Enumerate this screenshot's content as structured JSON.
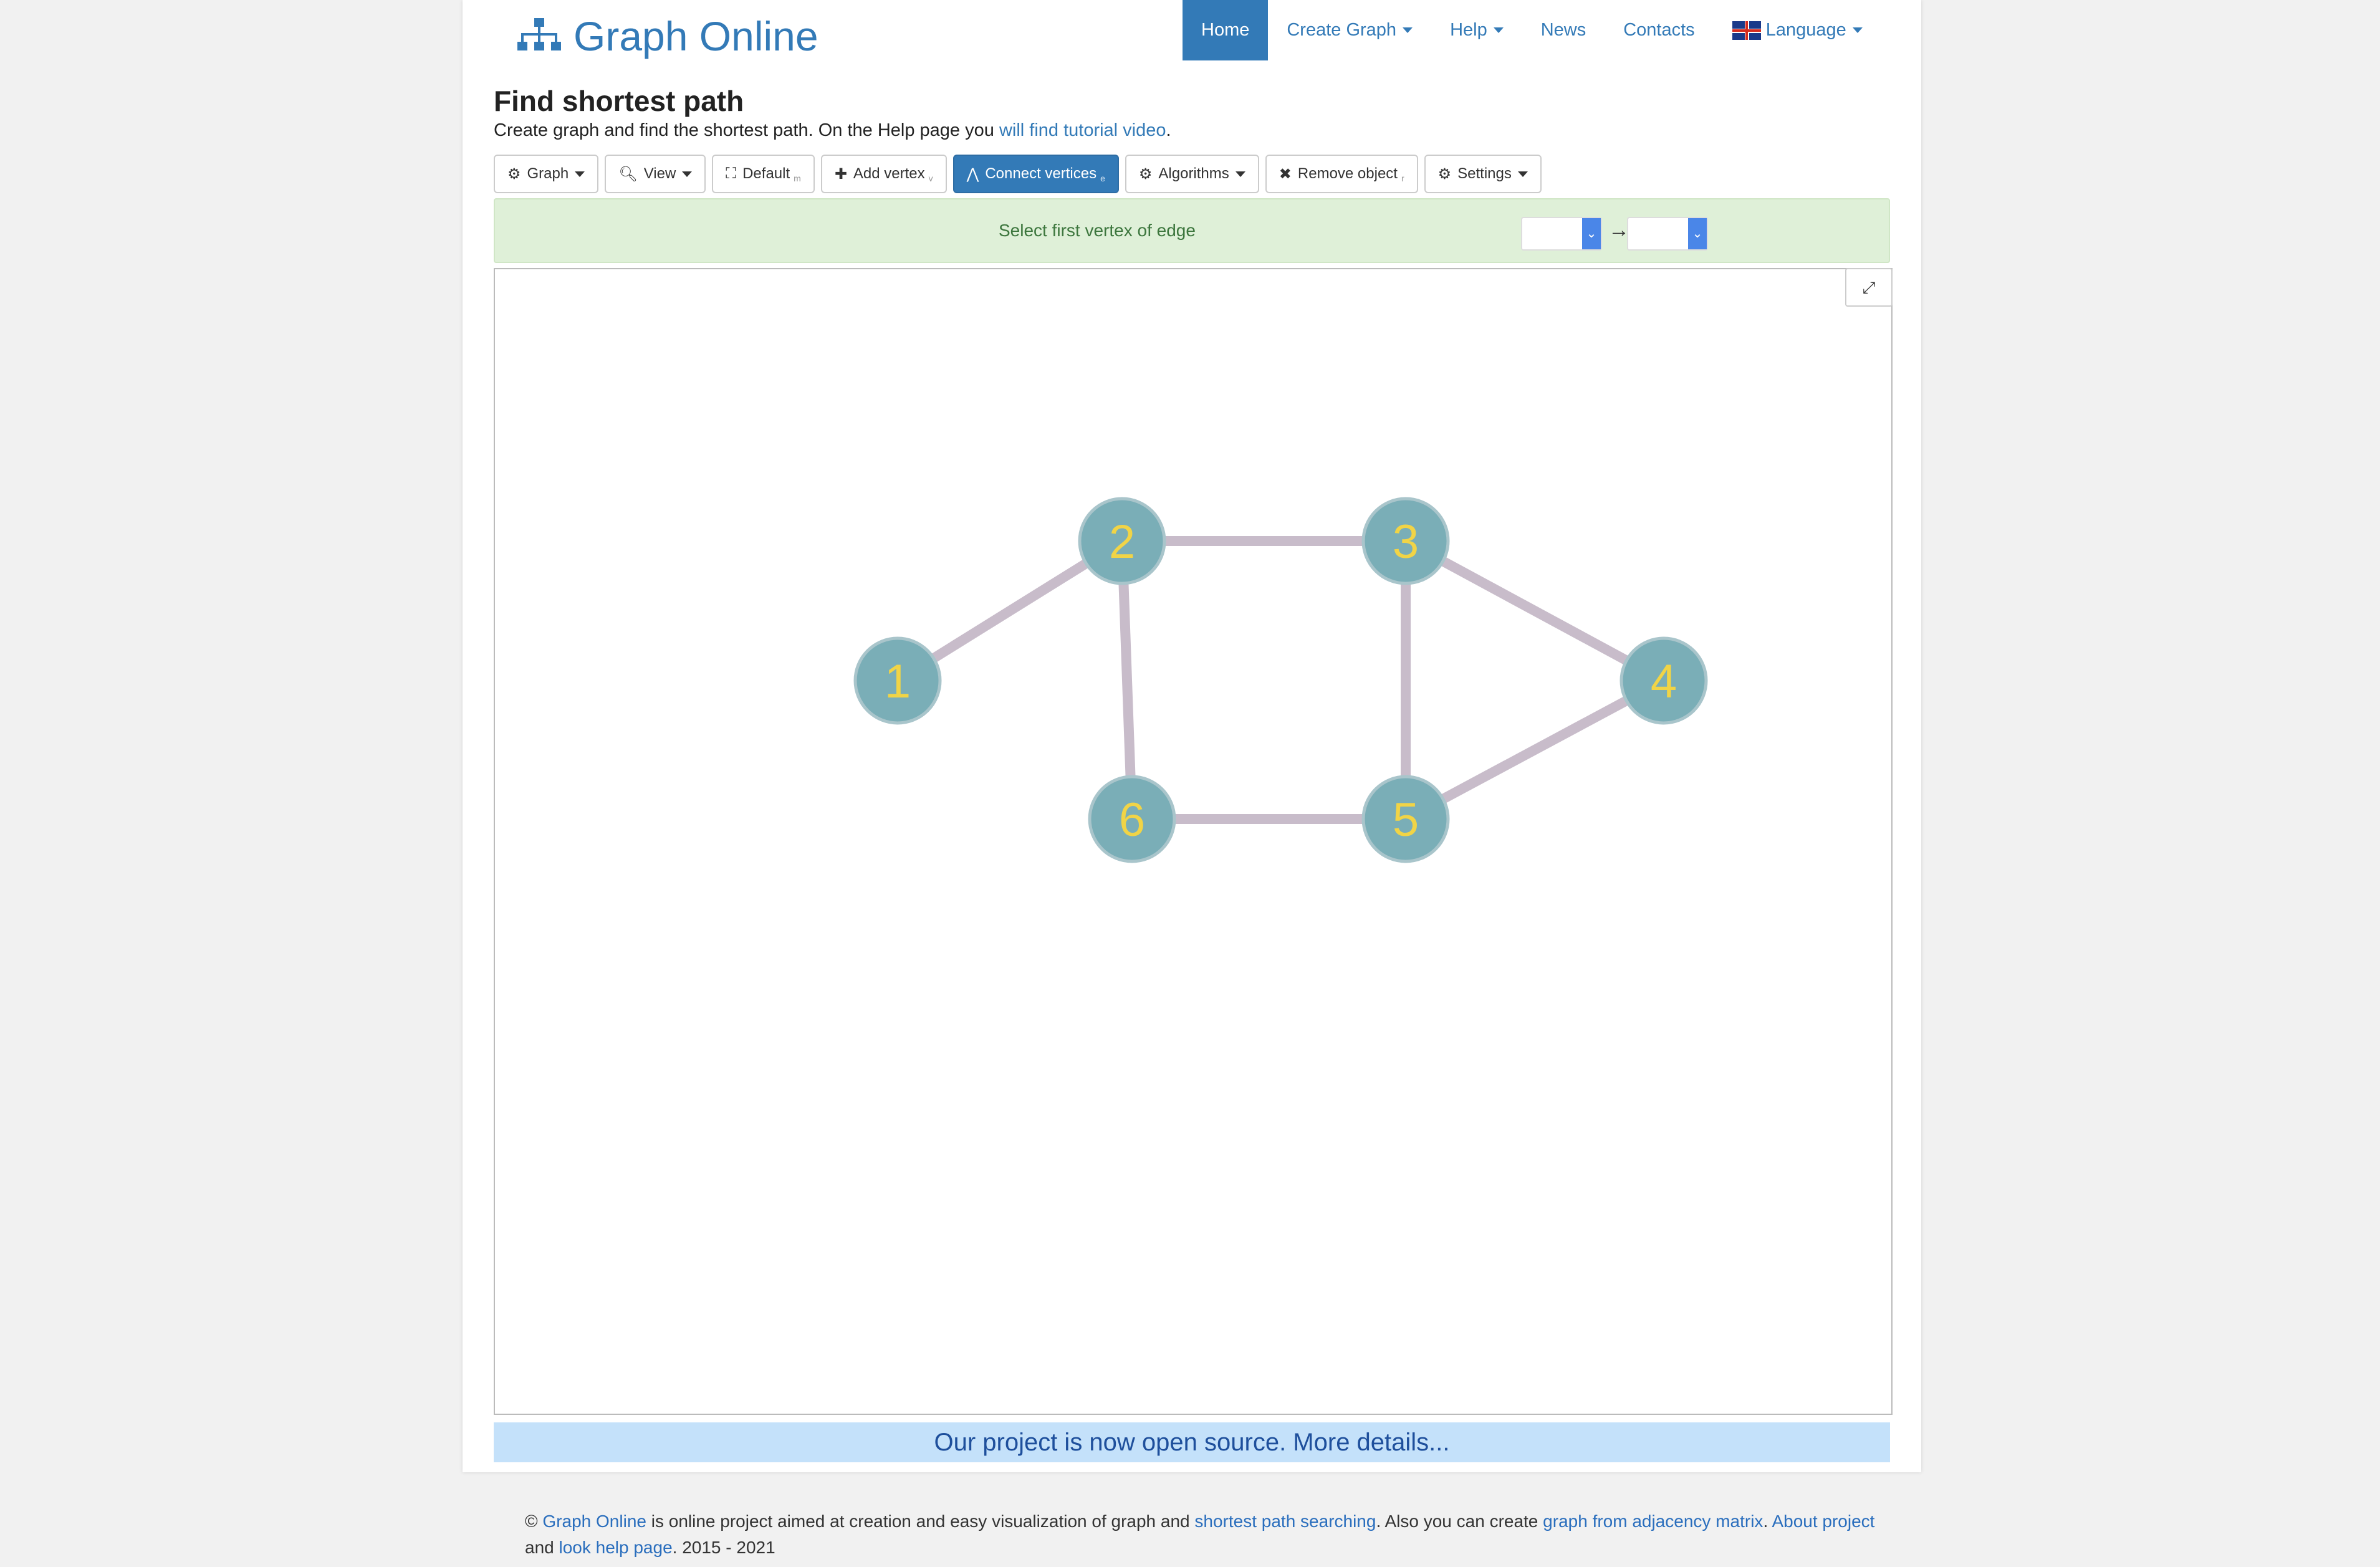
{
  "brand": {
    "name": "Graph Online",
    "icon": "sitemap-icon"
  },
  "nav": {
    "items": [
      {
        "label": "Home",
        "active": true
      },
      {
        "label": "Create Graph",
        "dropdown": true
      },
      {
        "label": "Help",
        "dropdown": true
      },
      {
        "label": "News"
      },
      {
        "label": "Contacts"
      }
    ],
    "language": {
      "label": "Language",
      "icon": "uk-flag-icon"
    }
  },
  "page": {
    "title": "Find shortest path",
    "subtitle_text": "Create graph and find the shortest path. On the Help page you ",
    "subtitle_link": "will find tutorial video",
    "subtitle_end": "."
  },
  "toolbar": {
    "graph": {
      "label": "Graph",
      "icon": "gear-icon"
    },
    "view": {
      "label": "View",
      "icon": "zoom-icon"
    },
    "default": {
      "label": "Default",
      "hotkey": "m",
      "icon": "fullscreen-icon"
    },
    "add_vertex": {
      "label": "Add vertex",
      "hotkey": "v",
      "icon": "plus-icon"
    },
    "connect": {
      "label": "Connect vertices",
      "hotkey": "e",
      "icon": "connect-icon"
    },
    "algorithms": {
      "label": "Algorithms",
      "icon": "gear-icon"
    },
    "remove": {
      "label": "Remove object",
      "hotkey": "r",
      "icon": "x-icon"
    },
    "settings": {
      "label": "Settings",
      "icon": "gear-icon"
    }
  },
  "alert": {
    "text": "Select first vertex of edge",
    "arrow": "→"
  },
  "graph": {
    "colors": {
      "vertex": "#7aaeb7",
      "vertex_label": "#f1d446",
      "edge": "#c8bcca",
      "vertex_border": "#a9c5cb"
    },
    "vertices": [
      {
        "id": "1",
        "label": "1"
      },
      {
        "id": "2",
        "label": "2"
      },
      {
        "id": "3",
        "label": "3"
      },
      {
        "id": "4",
        "label": "4"
      },
      {
        "id": "5",
        "label": "5"
      },
      {
        "id": "6",
        "label": "6"
      }
    ],
    "edges": [
      [
        "1",
        "2"
      ],
      [
        "2",
        "3"
      ],
      [
        "2",
        "6"
      ],
      [
        "3",
        "5"
      ],
      [
        "3",
        "4"
      ],
      [
        "4",
        "5"
      ],
      [
        "6",
        "5"
      ]
    ]
  },
  "banner": {
    "text": "Our project is now open source. More details..."
  },
  "footer": {
    "copy": "© ",
    "link1": "Graph Online",
    "text1": " is online project aimed at creation and easy visualization of graph and ",
    "link2": "shortest path searching",
    "text2": ". Also you can create ",
    "link3": "graph from adjacency matrix",
    "text3": ". ",
    "link4": "About project",
    "text4": " and ",
    "link5": "look help page",
    "text5": ". 2015 - 2021"
  }
}
